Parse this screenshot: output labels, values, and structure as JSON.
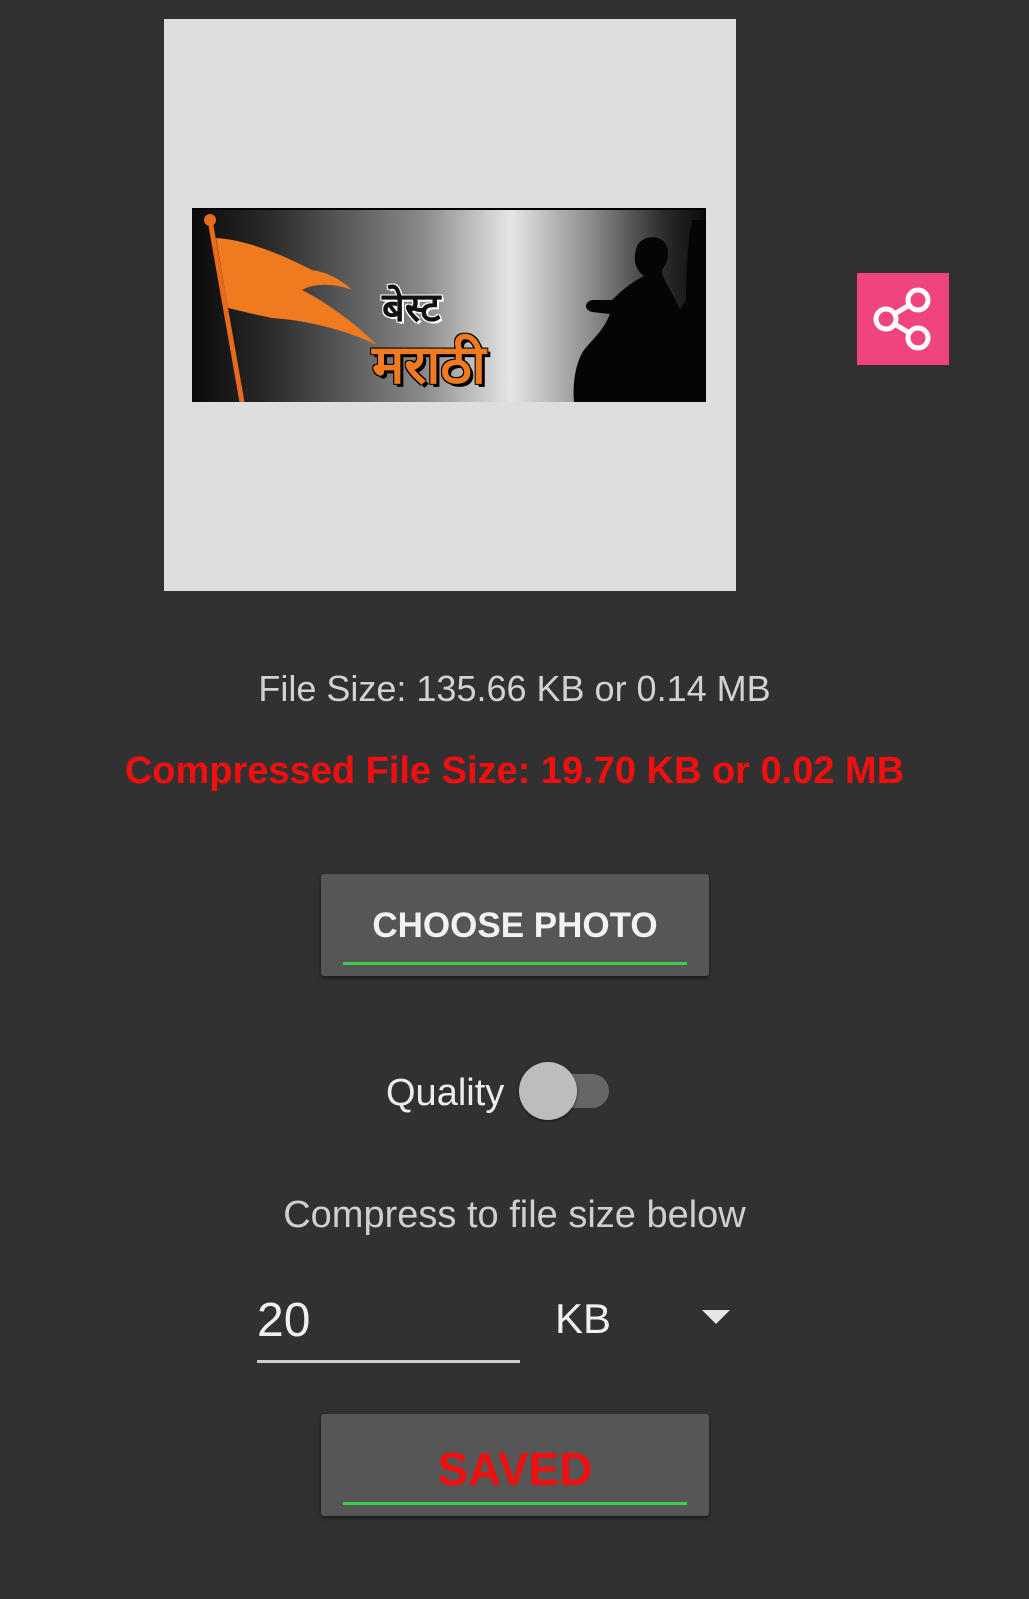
{
  "preview": {
    "banner_line1": "बेस्ट",
    "banner_line2": "मराठी"
  },
  "share_button": {
    "icon": "share-icon",
    "color": "#f0447f"
  },
  "file_size_text": "File Size: 135.66 KB or 0.14 MB",
  "compressed_size_text": "Compressed File Size: 19.70 KB or 0.02 MB",
  "choose_photo_label": "CHOOSE PHOTO",
  "quality": {
    "label": "Quality",
    "enabled": false
  },
  "compress_label": "Compress to file size below",
  "target_size": {
    "value": "20",
    "unit": "KB"
  },
  "saved_label": "SAVED",
  "colors": {
    "background": "#313131",
    "accent_red": "#f20f0f",
    "underline_green": "#3ad04a"
  }
}
